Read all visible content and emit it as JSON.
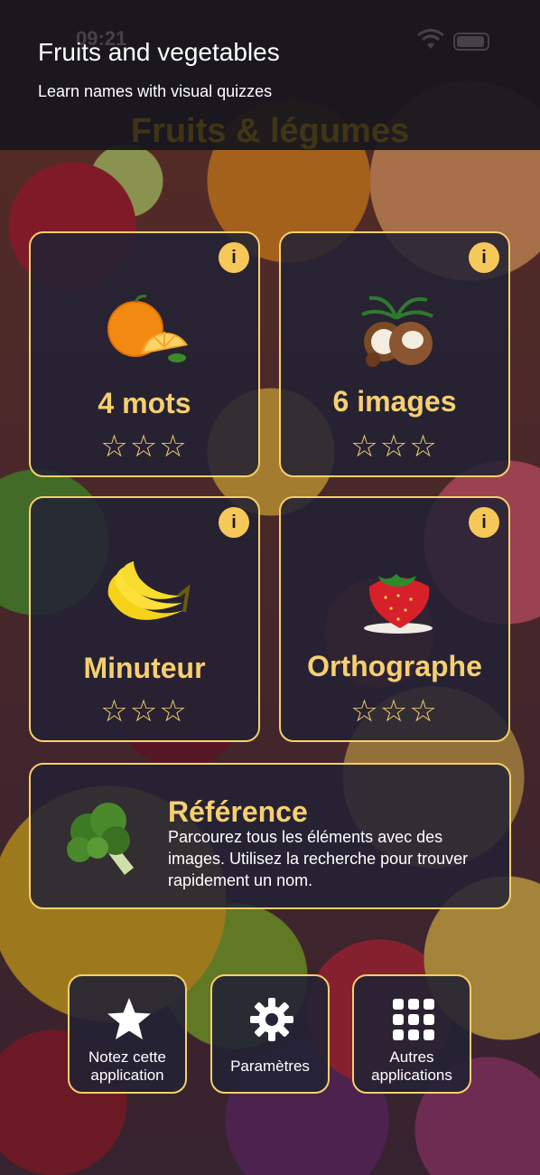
{
  "status": {
    "time": "09:21"
  },
  "overlay": {
    "title": "Fruits and vegetables",
    "subtitle": "Learn names with visual quizzes"
  },
  "app": {
    "title": "Fruits & légumes"
  },
  "modes": [
    {
      "label": "4 mots",
      "stars": "☆☆☆",
      "info": "i",
      "icon": "orange-icon"
    },
    {
      "label": "6 images",
      "stars": "☆☆☆",
      "info": "i",
      "icon": "coconut-icon"
    },
    {
      "label": "Minuteur",
      "stars": "☆☆☆",
      "info": "i",
      "icon": "banana-icon"
    },
    {
      "label": "Orthographe",
      "stars": "☆☆☆",
      "info": "i",
      "icon": "strawberry-icon"
    }
  ],
  "reference": {
    "title": "Référence",
    "description": "Parcourez tous les éléments avec des images. Utilisez la recherche pour trouver rapidement un nom.",
    "icon": "broccoli-icon"
  },
  "bottom": {
    "rate_line1": "Notez cette",
    "rate_line2": "application",
    "settings": "Paramètres",
    "more_line1": "Autres",
    "more_line2": "applications"
  },
  "colors": {
    "accent": "#f6d070",
    "card_border": "#f6d06a",
    "info_badge": "#f6c85a"
  }
}
